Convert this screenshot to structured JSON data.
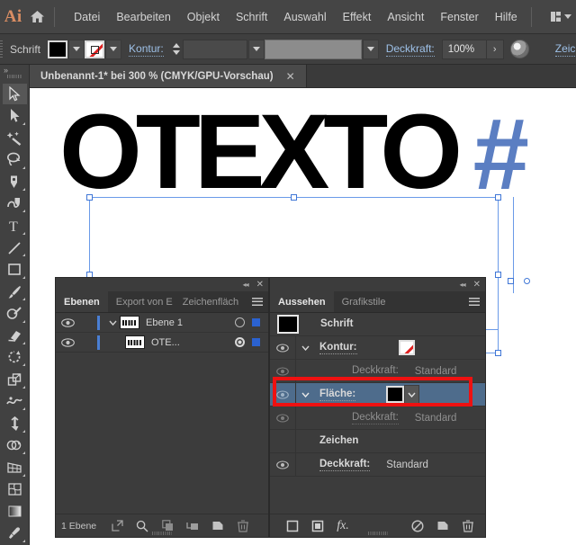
{
  "app": {
    "name": "Adobe Illustrator",
    "logo_text": "Ai",
    "home_icon": "home-icon"
  },
  "menubar": {
    "items": [
      {
        "label": "Datei"
      },
      {
        "label": "Bearbeiten"
      },
      {
        "label": "Objekt"
      },
      {
        "label": "Schrift"
      },
      {
        "label": "Auswahl"
      },
      {
        "label": "Effekt"
      },
      {
        "label": "Ansicht"
      },
      {
        "label": "Fenster"
      },
      {
        "label": "Hilfe"
      }
    ],
    "arrange_icon": "arrange-documents-icon",
    "arrange_chevron": "chevron-down-icon"
  },
  "controlbar": {
    "context_label": "Schrift",
    "fill_swatch": {
      "name": "fill-swatch",
      "color": "#000000"
    },
    "stroke_swatch": {
      "name": "stroke-swatch",
      "color": "none"
    },
    "stroke_label": "Kontur:",
    "stroke_weight_value": "",
    "stroke_profile_value": "",
    "opacity_label": "Deckkraft:",
    "opacity_value": "100%",
    "opacity_more": "›",
    "recolor_icon": "recolor-artwork-icon",
    "character_label": "Zeichen:"
  },
  "toolbar": {
    "collapse_icon": "chevron-double-right-icon",
    "tools": [
      {
        "name": "selection-tool",
        "active": true
      },
      {
        "name": "direct-selection-tool",
        "active": false
      },
      {
        "name": "magic-wand-tool",
        "active": false
      },
      {
        "name": "lasso-tool",
        "active": false
      },
      {
        "name": "pen-tool",
        "active": false
      },
      {
        "name": "curvature-tool",
        "active": false
      },
      {
        "name": "type-tool",
        "active": false
      },
      {
        "name": "line-segment-tool",
        "active": false
      },
      {
        "name": "rectangle-tool",
        "active": false
      },
      {
        "name": "paintbrush-tool",
        "active": false
      },
      {
        "name": "shaper-tool",
        "active": false
      },
      {
        "name": "eraser-tool",
        "active": false
      },
      {
        "name": "rotate-tool",
        "active": false
      },
      {
        "name": "scale-tool",
        "active": false
      },
      {
        "name": "width-tool",
        "active": false
      },
      {
        "name": "free-transform-tool",
        "active": false
      },
      {
        "name": "shape-builder-tool",
        "active": false
      },
      {
        "name": "perspective-grid-tool",
        "active": false
      },
      {
        "name": "mesh-tool",
        "active": false
      },
      {
        "name": "gradient-tool",
        "active": false
      },
      {
        "name": "eyedropper-tool",
        "active": false
      }
    ]
  },
  "document": {
    "tab_title": "Unbenannt-1* bei 300 % (CMYK/GPU-Vorschau)",
    "close_label": "✕"
  },
  "artwork": {
    "text": "OTEXTO",
    "text_color": "#000000",
    "overflow_marker": "#",
    "overflow_marker_color": "#5b7ec2",
    "selection_color": "#6a9ae8"
  },
  "layers_panel": {
    "topbar": {
      "collapse": "◂◂",
      "close": "✕"
    },
    "tabs": [
      {
        "label": "Ebenen",
        "active": true,
        "name": "tab-ebenen"
      },
      {
        "label": "Export von E",
        "active": false,
        "name": "tab-export-von-elementen"
      },
      {
        "label": "Zeichenfläch",
        "active": false,
        "name": "tab-zeichenflachen"
      }
    ],
    "menu_icon": "panel-menu-icon",
    "rows": [
      {
        "name": "Ebene 1",
        "visible": true,
        "indent": 0,
        "has_twisty": true,
        "target_selected": false,
        "selected": true
      },
      {
        "name": "OTE...",
        "visible": true,
        "indent": 1,
        "has_twisty": false,
        "target_selected": true,
        "selected": true
      }
    ],
    "footer": {
      "count_label": "1 Ebene",
      "buttons": [
        {
          "name": "locate-object-button",
          "icon": "locate-object-icon"
        },
        {
          "name": "search-layers-button",
          "icon": "search-icon"
        },
        {
          "name": "make-clipping-mask-button",
          "icon": "clipping-mask-icon"
        },
        {
          "name": "create-new-sublayer-button",
          "icon": "new-sublayer-icon"
        },
        {
          "name": "create-new-layer-button",
          "icon": "new-layer-icon"
        },
        {
          "name": "delete-selection-button",
          "icon": "trash-icon"
        }
      ]
    }
  },
  "appearance_panel": {
    "topbar": {
      "collapse": "◂◂",
      "close": "✕"
    },
    "tabs": [
      {
        "label": "Aussehen",
        "active": true,
        "name": "tab-aussehen"
      },
      {
        "label": "Grafikstile",
        "active": false,
        "name": "tab-grafikstile"
      }
    ],
    "menu_icon": "panel-menu-icon",
    "header_row": {
      "label": "Schrift",
      "thumb_color": "#000000"
    },
    "rows": [
      {
        "type": "stroke",
        "label": "Kontur:",
        "value": "",
        "swatch": "none",
        "visible": true,
        "twisty": true,
        "highlight": false
      },
      {
        "type": "opacity-sub",
        "label": "Deckkraft:",
        "value": "Standard",
        "swatch": null,
        "visible": true,
        "twisty": false,
        "highlight": false,
        "dim": true
      },
      {
        "type": "fill",
        "label": "Fläche:",
        "value": "",
        "swatch": "#000000",
        "visible": true,
        "twisty": true,
        "highlight": true
      },
      {
        "type": "opacity-sub",
        "label": "Deckkraft:",
        "value": "Standard",
        "swatch": null,
        "visible": true,
        "twisty": false,
        "highlight": false,
        "dim": true
      },
      {
        "type": "section",
        "label": "Zeichen",
        "value": "",
        "swatch": null,
        "visible": false,
        "twisty": false,
        "highlight": false
      },
      {
        "type": "opacity",
        "label": "Deckkraft:",
        "value": "Standard",
        "swatch": null,
        "visible": true,
        "twisty": false,
        "highlight": false
      }
    ],
    "annotation": {
      "name": "red-highlight-box",
      "color": "#ee1111",
      "target_row": "Fläche:"
    },
    "footer": {
      "buttons": [
        {
          "name": "add-new-stroke-button",
          "icon": "new-stroke-icon"
        },
        {
          "name": "add-new-fill-button",
          "icon": "new-fill-icon"
        },
        {
          "name": "add-new-effect-button",
          "icon": "fx-icon",
          "label": "fx."
        },
        {
          "name": "clear-appearance-button",
          "icon": "no-symbol-icon"
        },
        {
          "name": "duplicate-item-button",
          "icon": "duplicate-icon"
        },
        {
          "name": "delete-item-button",
          "icon": "trash-icon"
        }
      ]
    }
  }
}
